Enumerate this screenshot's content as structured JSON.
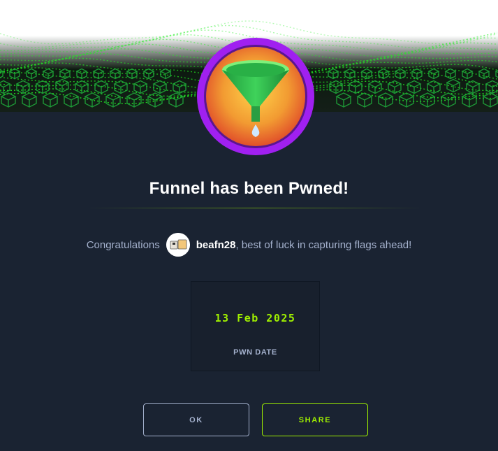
{
  "modal": {
    "title": "Funnel has been Pwned!",
    "congrats": {
      "prefix": "Congratulations",
      "username": "beafn28",
      "suffix": ", best of luck in capturing flags ahead!"
    },
    "stat": {
      "value": "13 Feb 2025",
      "label": "PWN DATE"
    },
    "buttons": {
      "ok_label": "OK",
      "share_label": "SHARE"
    }
  },
  "icons": {
    "badge": "funnel-icon",
    "banner": "green-grid-wave",
    "avatar": "user-avatar"
  },
  "colors": {
    "background": "#1a2332",
    "accent": "#9fef00",
    "muted_text": "#a4b1cd",
    "badge_ring": "#9b1bff",
    "badge_fill": "#f0a030",
    "funnel": "#2eb84a"
  }
}
